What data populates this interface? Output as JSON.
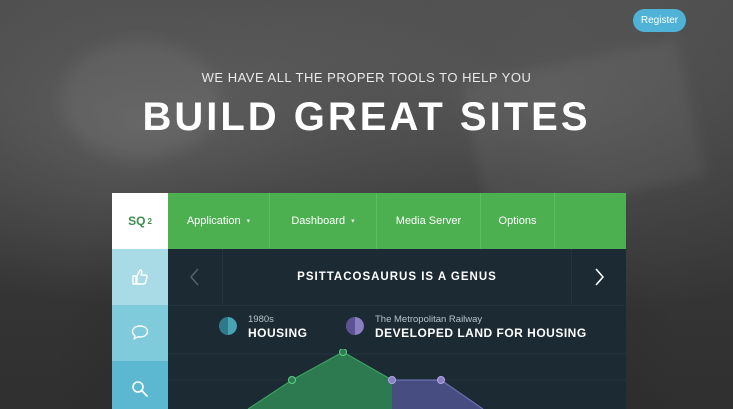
{
  "header": {
    "register_label": "Register",
    "tagline": "WE HAVE ALL THE PROPER TOOLS TO HELP YOU",
    "headline": "BUILD GREAT SITES"
  },
  "panel": {
    "logo": {
      "text": "SQ",
      "superscript": "2"
    },
    "nav": [
      {
        "label": "Application",
        "has_dropdown": true
      },
      {
        "label": "Dashboard",
        "has_dropdown": true
      },
      {
        "label": "Media Server",
        "has_dropdown": false
      },
      {
        "label": "Options",
        "has_dropdown": false
      }
    ],
    "sidebar": [
      {
        "icon": "thumbs-up-icon"
      },
      {
        "icon": "speech-bubble-icon"
      },
      {
        "icon": "search-icon"
      }
    ],
    "slider": {
      "title": "PSITTACOSAURUS IS A GENUS",
      "prev_icon": "chevron-left-icon",
      "next_icon": "chevron-right-icon"
    },
    "legend": [
      {
        "sub": "1980s",
        "main": "HOUSING",
        "color": "#4aa3b5",
        "dark": "#2f7a8a"
      },
      {
        "sub": "The Metropolitan Railway",
        "main": "DEVELOPED LAND FOR HOUSING",
        "color": "#8a7fc2",
        "dark": "#5d5394"
      }
    ]
  },
  "colors": {
    "register_bg": "#4eb3d6",
    "nav_green": "#4caf50",
    "panel_dark": "#1b2a33",
    "area_green": "#2e7d52",
    "area_purple": "#4a4f86"
  }
}
